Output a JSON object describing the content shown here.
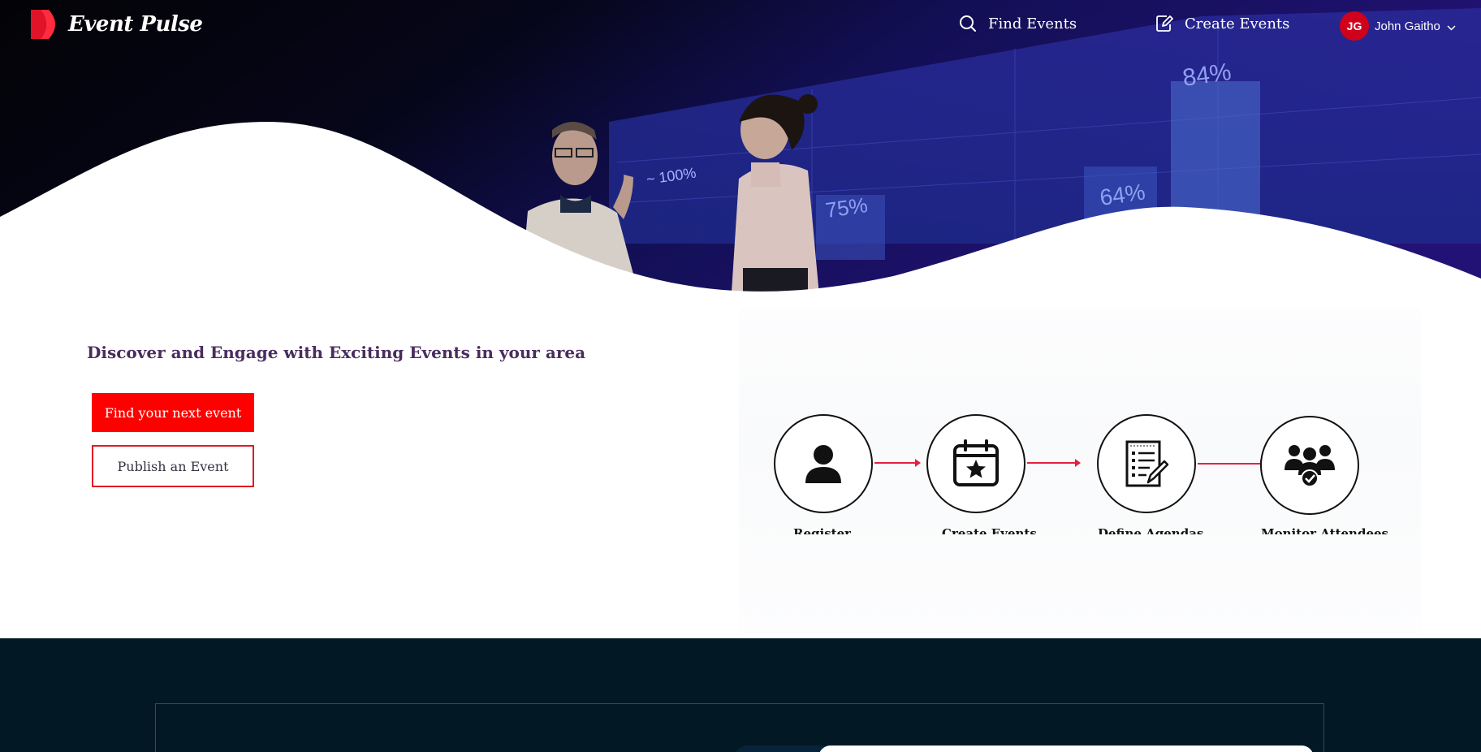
{
  "brand": {
    "name": "Event Pulse",
    "accent": "#ff0000"
  },
  "nav": {
    "find_events": "Find Events",
    "create_events": "Create Events",
    "user": {
      "initials": "JG",
      "name": "John Gaitho"
    }
  },
  "hero": {
    "screen_labels": [
      "~ 100%",
      "75%",
      "64%",
      "84%"
    ]
  },
  "main": {
    "tagline": "Discover and Engage with Exciting Events in your area",
    "primary_cta": "Find your next event",
    "secondary_cta": "Publish an Event"
  },
  "workflow": {
    "steps": [
      {
        "label": "Register",
        "icon": "person-icon"
      },
      {
        "label": "Create Events",
        "icon": "calendar-star-icon"
      },
      {
        "label": "Define Agendas",
        "icon": "checklist-icon"
      },
      {
        "label": "Monitor Attendees",
        "icon": "group-check-icon"
      }
    ]
  },
  "colors": {
    "nav_text": "#ffffff",
    "tagline": "#4a2d5e",
    "footer_bg": "#021824",
    "avatar": "#d0021b"
  }
}
